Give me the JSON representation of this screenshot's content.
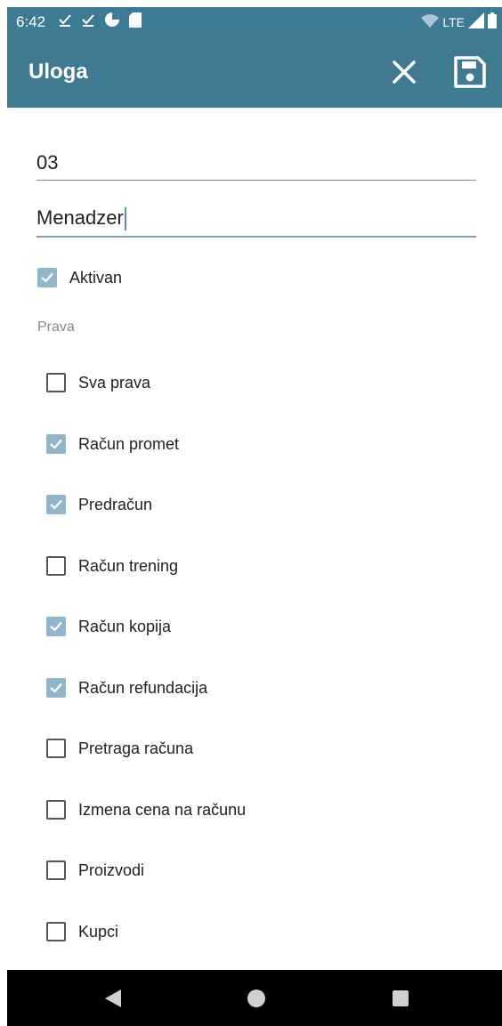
{
  "status_bar": {
    "time": "6:42",
    "network": "LTE"
  },
  "app_bar": {
    "title": "Uloga",
    "close_icon": "close-icon",
    "save_icon": "save-icon",
    "color": "#3f7a91"
  },
  "form": {
    "code_value": "03",
    "name_value": "Menadzer",
    "active": {
      "label": "Aktivan",
      "checked": true
    },
    "rights_label": "Prava",
    "rights": [
      {
        "label": "Sva prava",
        "checked": false
      },
      {
        "label": "Račun promet",
        "checked": true
      },
      {
        "label": "Predračun",
        "checked": true
      },
      {
        "label": "Račun trening",
        "checked": false
      },
      {
        "label": "Račun kopija",
        "checked": true
      },
      {
        "label": "Račun refundacija",
        "checked": true
      },
      {
        "label": "Pretraga računa",
        "checked": false
      },
      {
        "label": "Izmena cena na računu",
        "checked": false
      },
      {
        "label": "Proizvodi",
        "checked": false
      },
      {
        "label": "Kupci",
        "checked": false
      }
    ]
  },
  "colors": {
    "accent": "#93b5ca",
    "status_bar": "#3d7a94"
  }
}
